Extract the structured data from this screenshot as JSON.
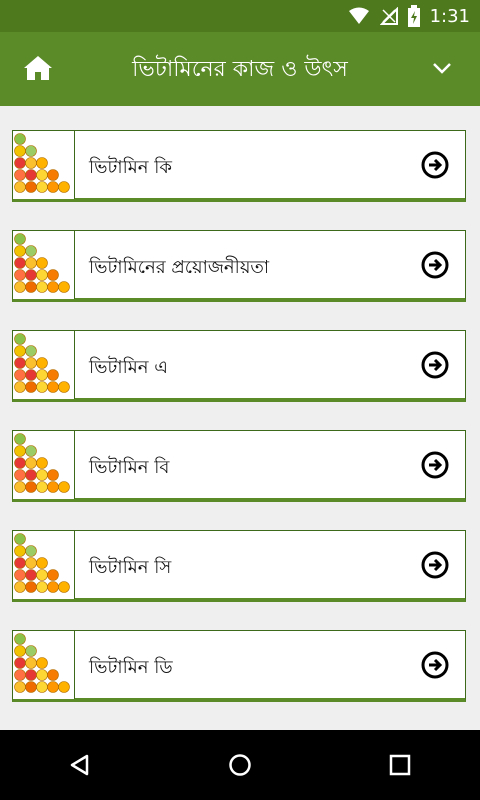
{
  "status": {
    "time": "1:31"
  },
  "appbar": {
    "title": "ভিটামিনের কাজ ও উৎস"
  },
  "items": [
    {
      "label": "ভিটামিন কি"
    },
    {
      "label": "ভিটামিনের প্রয়োজনীয়তা"
    },
    {
      "label": "ভিটামিন এ"
    },
    {
      "label": "ভিটামিন বি"
    },
    {
      "label": "ভিটামিন সি"
    },
    {
      "label": "ভিটামিন ডি"
    },
    {
      "label": ""
    }
  ],
  "colors": {
    "statusbar": "#4e7a1d",
    "appbar": "#5b8a28",
    "border": "#3d6a1a"
  },
  "icons": {
    "home": "home-icon",
    "chevron": "chevron-down-icon",
    "arrow": "arrow-right-circle-icon"
  }
}
